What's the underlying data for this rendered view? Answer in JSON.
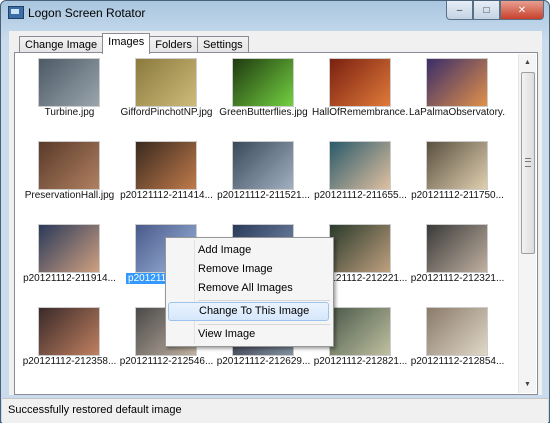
{
  "window": {
    "title": "Logon Screen Rotator",
    "minimize": "‒",
    "maximize": "□",
    "close": "✕"
  },
  "tabs": [
    "Change Image",
    "Images",
    "Folders",
    "Settings"
  ],
  "active_tab": "Images",
  "images": [
    {
      "caption": "Turbine.jpg",
      "colors": [
        "#4c5a66",
        "#9aa5ad"
      ]
    },
    {
      "caption": "GiffordPinchotNP.jpg",
      "colors": [
        "#8a7a3c",
        "#cdbb7a"
      ]
    },
    {
      "caption": "GreenButterflies.jpg",
      "colors": [
        "#203a10",
        "#72d040"
      ]
    },
    {
      "caption": "HallOfRemembrance....",
      "colors": [
        "#7a2010",
        "#e07a3a"
      ]
    },
    {
      "caption": "LaPalmaObservatory....",
      "colors": [
        "#3a2d6a",
        "#e0904a"
      ]
    },
    {
      "caption": "PreservationHall.jpg",
      "colors": [
        "#5a3a2a",
        "#b08060"
      ]
    },
    {
      "caption": "p20121112-211414...",
      "colors": [
        "#3a2a20",
        "#c07a4a"
      ]
    },
    {
      "caption": "p20121112-211521...",
      "colors": [
        "#3a4a5a",
        "#a0b0c0"
      ]
    },
    {
      "caption": "p20121112-211655...",
      "colors": [
        "#2a5a6a",
        "#e0c0a0"
      ]
    },
    {
      "caption": "p20121112-211750...",
      "colors": [
        "#5a5040",
        "#e0d0b0"
      ]
    },
    {
      "caption": "p20121112-211914...",
      "colors": [
        "#2a3a5a",
        "#d0a080"
      ]
    },
    {
      "caption": "p20121112-212...",
      "colors": [
        "#4a5a8a",
        "#a0b8e0"
      ]
    },
    {
      "caption": "p20121112-212...",
      "colors": [
        "#2a3a5a",
        "#8090b0"
      ]
    },
    {
      "caption": "p20121112-212221...",
      "colors": [
        "#2a3a2a",
        "#c0a080"
      ]
    },
    {
      "caption": "p20121112-212321...",
      "colors": [
        "#3a3a3a",
        "#c0b0a0"
      ]
    },
    {
      "caption": "p20121112-212358...",
      "colors": [
        "#3a2a2a",
        "#c08060"
      ]
    },
    {
      "caption": "p20121112-212546...",
      "colors": [
        "#4a4a4a",
        "#c0b0a0"
      ]
    },
    {
      "caption": "p20121112-212629...",
      "colors": [
        "#2a2a3a",
        "#8090a0"
      ]
    },
    {
      "caption": "p20121112-212821...",
      "colors": [
        "#4a5a4a",
        "#c0c0a0"
      ]
    },
    {
      "caption": "p20121112-212854...",
      "colors": [
        "#8a7a6a",
        "#e0d8c8"
      ]
    }
  ],
  "selected_index": 11,
  "context_menu": {
    "items": [
      "Add Image",
      "Remove Image",
      "Remove All Images",
      "Change To This Image",
      "View Image"
    ],
    "highlighted": "Change To This Image"
  },
  "scrollbar": {
    "up": "▲",
    "down": "▼"
  },
  "status": "Successfully restored default image"
}
